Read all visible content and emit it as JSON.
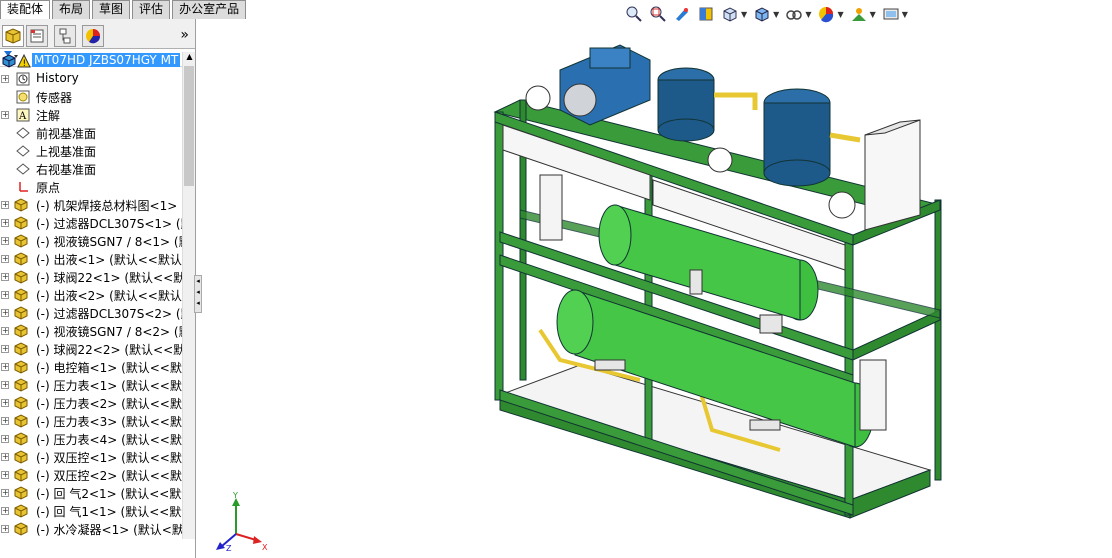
{
  "tabs": [
    {
      "label": "装配体"
    },
    {
      "label": "布局"
    },
    {
      "label": "草图"
    },
    {
      "label": "评估"
    },
    {
      "label": "办公室产品"
    }
  ],
  "panel": {
    "tab_icons": [
      "feature-manager-icon",
      "property-manager-icon",
      "configuration-manager-icon",
      "appearance-manager-icon"
    ],
    "expand_label": "»",
    "filter_icon": "filter-icon"
  },
  "tree": {
    "root": "MT07HD JZBS07HGY MT",
    "items": [
      {
        "label": "History"
      },
      {
        "label": "传感器"
      },
      {
        "label": "注解"
      },
      {
        "label": "前视基准面"
      },
      {
        "label": "上视基准面"
      },
      {
        "label": "右视基准面"
      },
      {
        "label": "原点"
      },
      {
        "label": "(-) 机架焊接总材料图<1>"
      },
      {
        "label": "(-) 过滤器DCL307S<1> (默"
      },
      {
        "label": "(-) 视液镜SGN7 / 8<1> (默"
      },
      {
        "label": "(-) 出液<1> (默认<<默认"
      },
      {
        "label": "(-) 球阀22<1> (默认<<默"
      },
      {
        "label": "(-) 出液<2> (默认<<默认"
      },
      {
        "label": "(-) 过滤器DCL307S<2> (默"
      },
      {
        "label": "(-) 视液镜SGN7 / 8<2> (默"
      },
      {
        "label": "(-) 球阀22<2> (默认<<默"
      },
      {
        "label": "(-) 电控箱<1> (默认<<默认"
      },
      {
        "label": "(-) 压力表<1> (默认<<默认"
      },
      {
        "label": "(-) 压力表<2> (默认<<默认"
      },
      {
        "label": "(-) 压力表<3> (默认<<默认"
      },
      {
        "label": "(-) 压力表<4> (默认<<默认"
      },
      {
        "label": "(-) 双压控<1> (默认<<默认"
      },
      {
        "label": "(-) 双压控<2> (默认<<默认"
      },
      {
        "label": "(-) 回 气2<1> (默认<<默认"
      },
      {
        "label": "(-) 回 气1<1> (默认<<默认"
      },
      {
        "label": "(-) 水冷凝器<1> (默认<默"
      }
    ]
  },
  "hud": {
    "icons": [
      "zoom-to-fit-icon",
      "zoom-area-icon",
      "previous-view-icon",
      "section-view-icon",
      "view-orientation-icon",
      "display-style-icon",
      "hide-show-icon",
      "edit-appearance-icon",
      "apply-scene-icon",
      "view-settings-icon"
    ]
  },
  "triad": {
    "x": "X",
    "y": "Y",
    "z": "Z"
  },
  "colors": {
    "frame_green": "#2f8a2f",
    "part_green": "#3fbf3f",
    "compressor_blue": "#1d5a8a",
    "selection": "#3399ff"
  }
}
